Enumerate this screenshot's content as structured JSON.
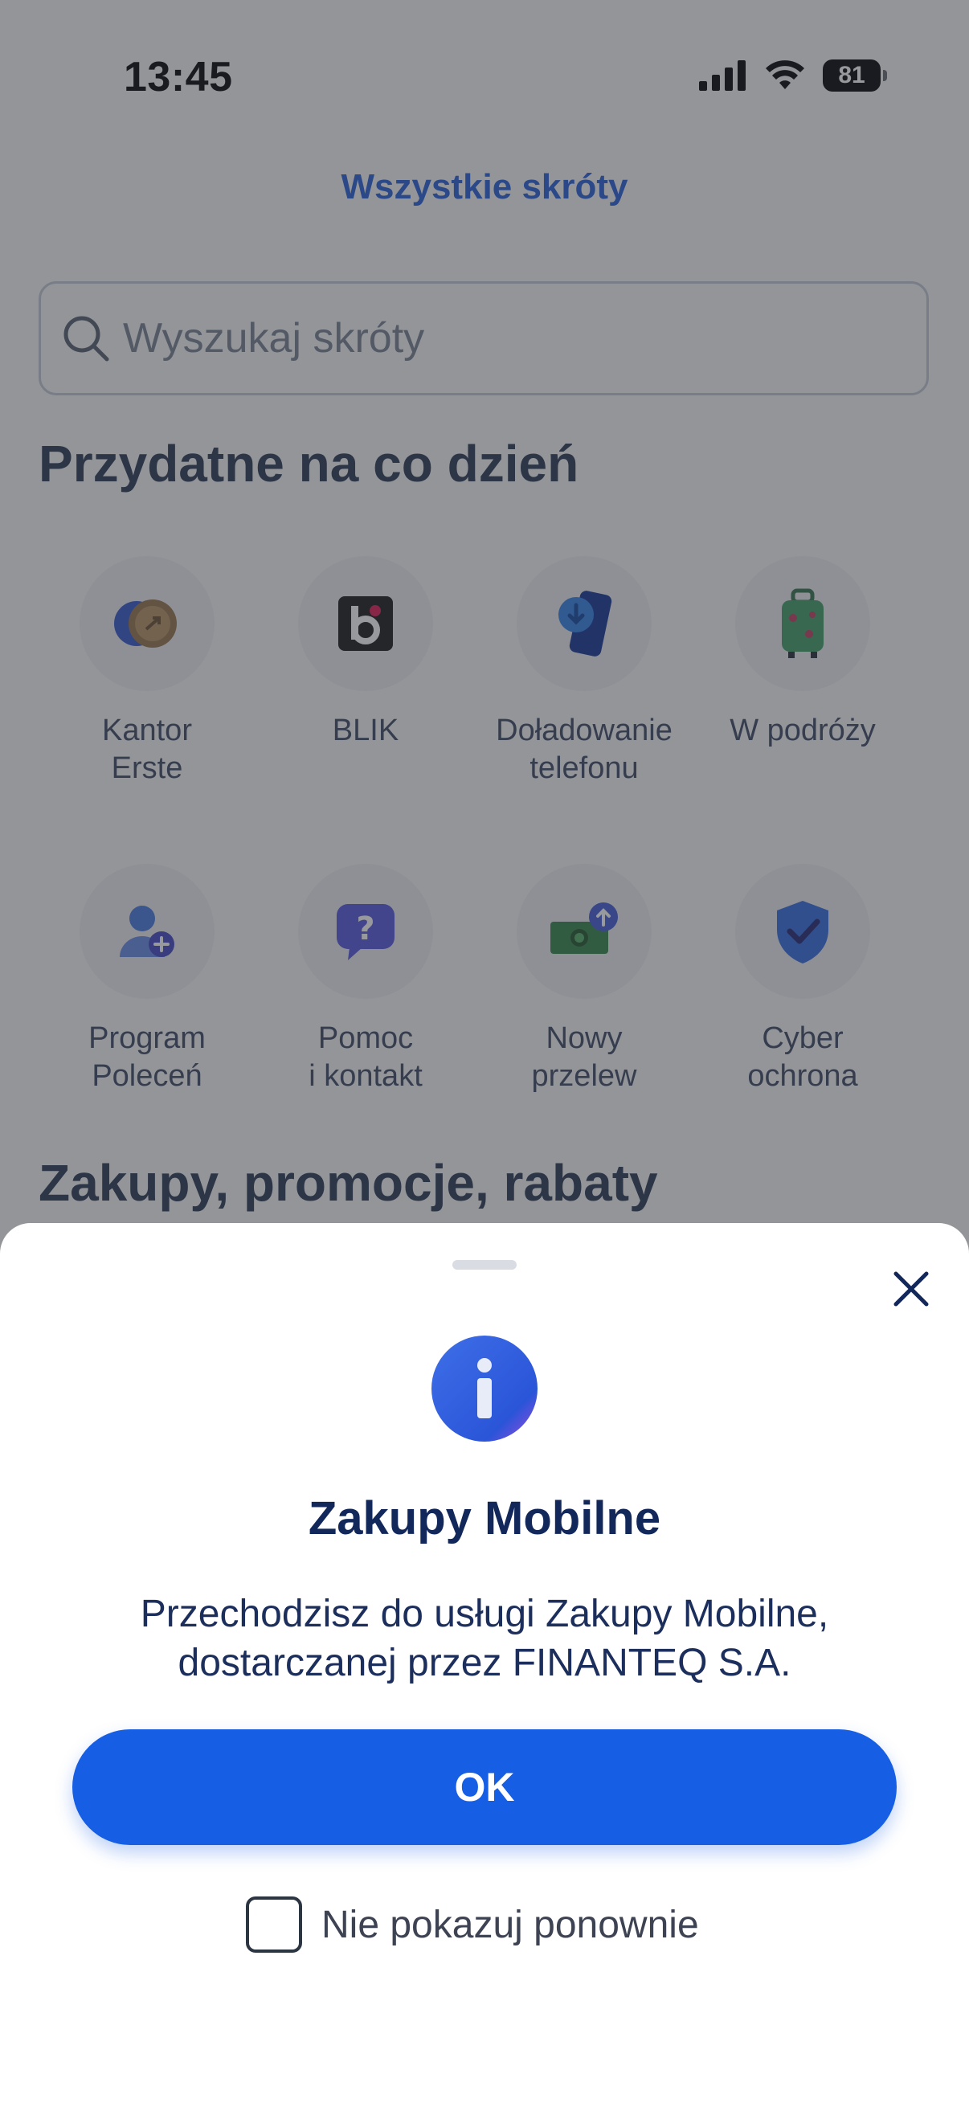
{
  "status_bar": {
    "time": "13:45",
    "battery": "81"
  },
  "header": {
    "title": "Wszystkie skróty"
  },
  "search": {
    "placeholder": "Wyszukaj skróty"
  },
  "sections": [
    {
      "title": "Przydatne na co dzień",
      "items": [
        {
          "label": "Kantor\nErste",
          "icon": "currency-exchange-icon"
        },
        {
          "label": "BLIK",
          "icon": "blik-icon"
        },
        {
          "label": "Doładowanie\ntelefonu",
          "icon": "phone-topup-icon"
        },
        {
          "label": "W podróży",
          "icon": "suitcase-icon"
        },
        {
          "label": "Program\nPoleceń",
          "icon": "add-person-icon"
        },
        {
          "label": "Pomoc\ni kontakt",
          "icon": "help-chat-icon"
        },
        {
          "label": "Nowy\nprzelew",
          "icon": "money-transfer-icon"
        },
        {
          "label": "Cyber\nochrona",
          "icon": "shield-check-icon"
        }
      ]
    },
    {
      "title": "Zakupy, promocje, rabaty"
    }
  ],
  "sheet": {
    "icon": "info-icon",
    "title": "Zakupy Mobilne",
    "message": "Przechodzisz do usługi Zakupy Mobilne, dostarczanej przez FINANTEQ S.A.",
    "ok_label": "OK",
    "dont_show_label": "Nie pokazuj ponownie",
    "dont_show_checked": false
  },
  "colors": {
    "accent": "#165ee3",
    "title_link": "#2e66d8",
    "sheet_title": "#12275a"
  }
}
